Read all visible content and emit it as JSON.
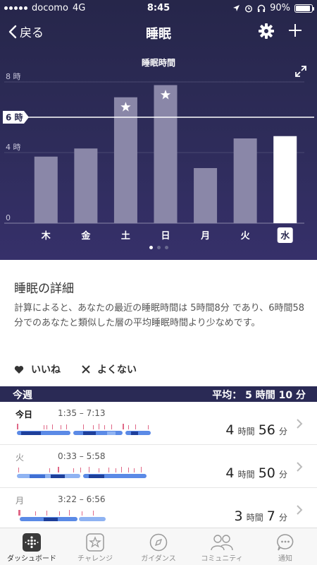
{
  "status": {
    "carrier": "docomo",
    "network": "4G",
    "time": "8:45",
    "battery": "90%",
    "battery_level": 0.9
  },
  "nav": {
    "back_label": "戻る",
    "title": "睡眠"
  },
  "chart_data": {
    "type": "bar",
    "title": "睡眠時間",
    "categories": [
      "木",
      "金",
      "土",
      "日",
      "月",
      "火",
      "水"
    ],
    "values": [
      3.77,
      4.23,
      7.13,
      7.82,
      3.12,
      4.8,
      4.93
    ],
    "starred": [
      false,
      false,
      true,
      true,
      false,
      false,
      false
    ],
    "highlighted_index": 6,
    "goal": 6,
    "goal_label": "6 時",
    "ylim": [
      0,
      8
    ],
    "yticks": [
      {
        "v": 0,
        "label": "0"
      },
      {
        "v": 4,
        "label": "4 時"
      },
      {
        "v": 8,
        "label": "8 時"
      }
    ]
  },
  "details": {
    "title": "睡眠の詳細",
    "body": "計算によると、あなたの最近の睡眠時間は 5時間8分 であり、6時間58分でのあなたと類似した層の平均睡眠時間より少なめです。",
    "like": "いいね",
    "dislike": "よくない"
  },
  "week": {
    "label": "今週",
    "average": "平均： 5 時間 10 分"
  },
  "rows": [
    {
      "day": "今日",
      "range": "1:35 – 7:13",
      "hours": "4",
      "hours_unit": "時間",
      "minutes": "56",
      "minutes_unit": "分"
    },
    {
      "day": "火",
      "range": "0:33 – 5:58",
      "hours": "4",
      "hours_unit": "時間",
      "minutes": "50",
      "minutes_unit": "分"
    },
    {
      "day": "月",
      "range": "3:22 – 6:56",
      "hours": "3",
      "hours_unit": "時間",
      "minutes": "7",
      "minutes_unit": "分"
    }
  ],
  "tabs": [
    {
      "label": "ダッシュボード",
      "icon": "dashboard-icon"
    },
    {
      "label": "チャレンジ",
      "icon": "star-icon"
    },
    {
      "label": "ガイダンス",
      "icon": "compass-icon"
    },
    {
      "label": "コミュニティ",
      "icon": "people-icon"
    },
    {
      "label": "通知",
      "icon": "chat-icon"
    }
  ],
  "colors": {
    "bg_top": "#26264a",
    "bar": "#8a87a8",
    "bar_today": "#ffffff",
    "accent_blue": "#3f6fd4",
    "awake": "#d9436a"
  }
}
